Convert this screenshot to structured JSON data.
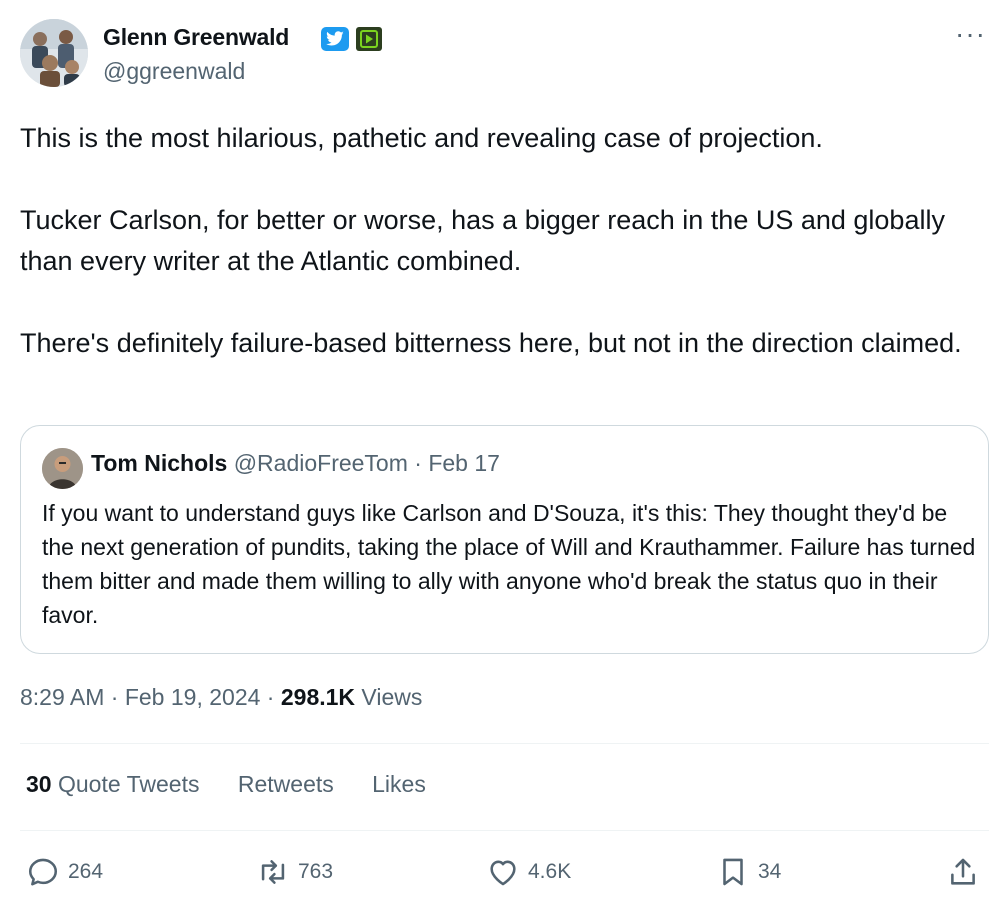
{
  "author": {
    "name": "Glenn Greenwald",
    "handle": "@ggreenwald",
    "badges": [
      "verified-badge-icon",
      "app-badge-icon"
    ]
  },
  "tweet": {
    "paragraphs": [
      "This is the most hilarious, pathetic and revealing case of projection.",
      "Tucker Carlson, for better or worse, has a bigger reach in the US and globally than every writer at the Atlantic combined.",
      "There's definitely failure-based bitterness here, but not in the direction claimed."
    ]
  },
  "quote": {
    "name": "Tom Nichols",
    "handle": "@RadioFreeTom",
    "date": "Feb 17",
    "text": "If you want to understand guys like Carlson and D'Souza, it's this: They thought they'd be the next generation of pundits, taking the place of Will and Krauthammer. Failure has turned them bitter and made them willing to ally with anyone who'd break the status quo in their favor."
  },
  "meta": {
    "time": "8:29 AM",
    "date": "Feb 19, 2024",
    "views_count": "298.1K",
    "views_label": "Views"
  },
  "stats": {
    "quote_count": "30",
    "quote_label": "Quote Tweets",
    "retweets_label": "Retweets",
    "likes_label": "Likes"
  },
  "actions": {
    "replies": "264",
    "retweets": "763",
    "likes": "4.6K",
    "bookmarks": "34"
  },
  "colors": {
    "text": "#0f1419",
    "secondary": "#536471",
    "verified": "#1d9bf0",
    "border": "#cfd9de"
  }
}
